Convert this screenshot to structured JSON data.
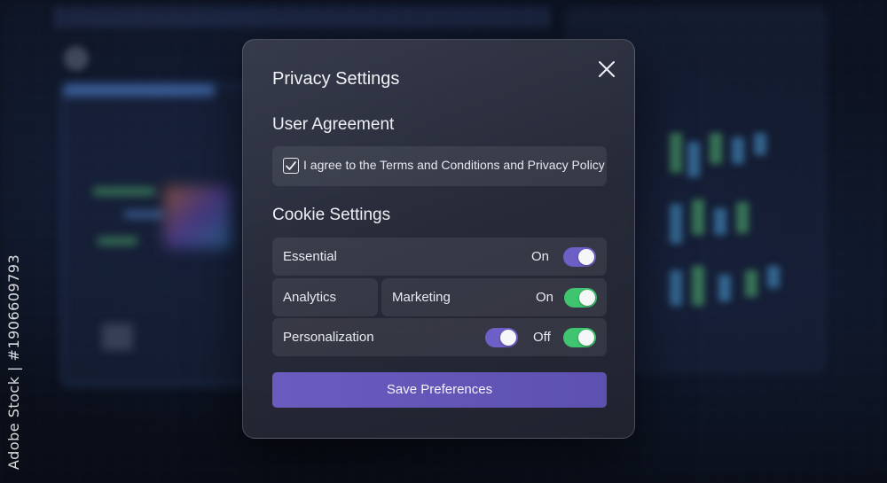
{
  "modal": {
    "title": "Privacy Settings",
    "close_icon": "close-icon"
  },
  "user_agreement": {
    "section_title": "User Agreement",
    "checkbox_checked": true,
    "agree_text": "I agree to the Terms and Conditions and Privacy Policy"
  },
  "cookies": {
    "section_title": "Cookie Settings",
    "essential": {
      "label": "Essential",
      "state": "On",
      "enabled": true
    },
    "analytics": {
      "label": "Analytics"
    },
    "marketing": {
      "label": "Marketing",
      "state": "On",
      "enabled": true
    },
    "personalization": {
      "label": "Personalization",
      "state": "Off"
    }
  },
  "actions": {
    "save_label": "Save Preferences"
  },
  "colors": {
    "toggle_purple": "#6c5fc6",
    "toggle_green": "#3fc46f",
    "button_accent": "#6a5cbf"
  },
  "watermark_side_text": "Adobe Stock | #1906609793"
}
